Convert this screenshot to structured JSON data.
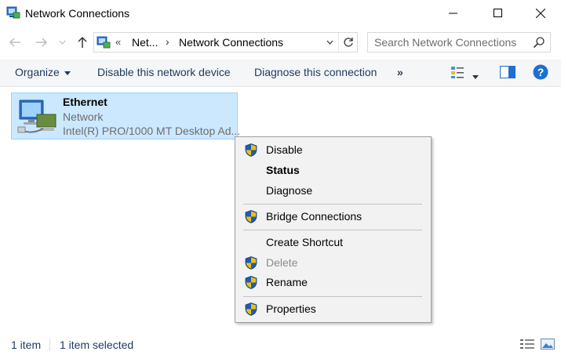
{
  "window": {
    "title": "Network Connections",
    "icons": {
      "app": "network-connections-icon",
      "minimize": "minimize-icon",
      "maximize": "maximize-icon",
      "close": "close-icon"
    }
  },
  "address_bar": {
    "breadcrumb_overflow": "«",
    "segment1": "Net...",
    "separator": "›",
    "segment2": "Network Connections",
    "icons": {
      "back": "arrow-left-icon",
      "forward": "arrow-right-icon",
      "recent": "chevron-down-icon",
      "up": "arrow-up-icon",
      "dropdown": "chevron-down-icon",
      "refresh": "refresh-icon"
    }
  },
  "search": {
    "placeholder": "Search Network Connections",
    "value": "",
    "icon": "search-icon"
  },
  "command_bar": {
    "organize": "Organize",
    "disable": "Disable this network device",
    "diagnose": "Diagnose this connection",
    "more": "»",
    "icons": {
      "view_options": "change-view-icon",
      "preview_pane": "preview-pane-icon",
      "help": "help-icon"
    }
  },
  "items": [
    {
      "name": "Ethernet",
      "status": "Network",
      "device": "Intel(R) PRO/1000 MT Desktop Ad...",
      "selected": true
    }
  ],
  "context_menu": {
    "items": [
      {
        "label": "Disable",
        "shield": true
      },
      {
        "label": "Status",
        "bold": true
      },
      {
        "label": "Diagnose"
      },
      {
        "label": "Bridge Connections",
        "shield": true
      },
      {
        "label": "Create Shortcut"
      },
      {
        "label": "Delete",
        "shield": true,
        "disabled": true
      },
      {
        "label": "Rename",
        "shield": true
      },
      {
        "label": "Properties",
        "shield": true
      }
    ]
  },
  "status_bar": {
    "count": "1 item",
    "selected": "1 item selected",
    "icons": {
      "details_view": "details-view-icon",
      "large_icons_view": "large-icons-view-icon"
    }
  },
  "colors": {
    "accent": "#1e395b",
    "selection_bg": "#cce8ff",
    "selection_border": "#99d1ff",
    "help_blue": "#1f6fd0",
    "shield_blue": "#1e5bb5",
    "shield_yellow": "#f2c000"
  }
}
